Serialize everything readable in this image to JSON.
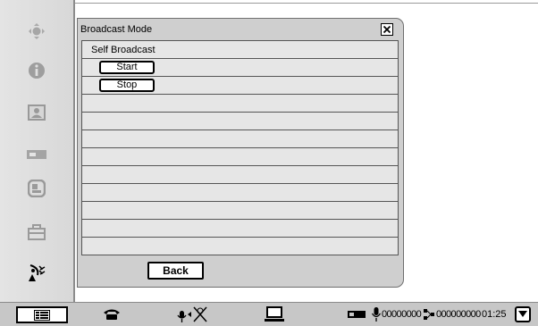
{
  "dialog": {
    "title": "Broadcast Mode",
    "rows": [
      {
        "type": "text",
        "label": "Self Broadcast"
      },
      {
        "type": "button",
        "label": "Start"
      },
      {
        "type": "button",
        "label": "Stop"
      },
      {
        "type": "empty"
      },
      {
        "type": "empty"
      },
      {
        "type": "empty"
      },
      {
        "type": "empty"
      },
      {
        "type": "empty"
      },
      {
        "type": "empty"
      },
      {
        "type": "empty"
      },
      {
        "type": "empty"
      },
      {
        "type": "empty"
      }
    ],
    "back_label": "Back"
  },
  "sidebar": {
    "items": [
      {
        "icon": "camera-control-icon"
      },
      {
        "icon": "info-icon"
      },
      {
        "icon": "contact-icon"
      },
      {
        "icon": "source-icon"
      },
      {
        "icon": "layout-icon"
      },
      {
        "icon": "toolbox-icon"
      },
      {
        "icon": "satellite-icon"
      }
    ]
  },
  "statusbar": {
    "menu_icon": "menu-list-icon",
    "phone_icon": "phone-icon",
    "mic_mute_icon": "mic-mute-icon",
    "display_icon": "laptop-icon",
    "video_icon": "video-source-icon",
    "mic_level": "00000000",
    "net_level": "000000000",
    "time": "01:25"
  }
}
